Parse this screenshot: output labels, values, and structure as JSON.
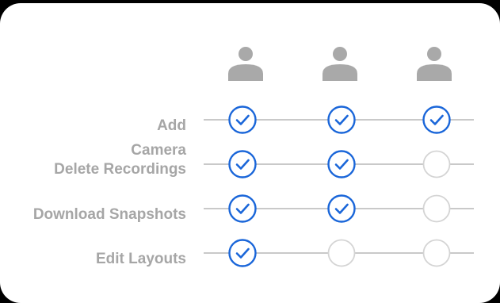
{
  "permissions_matrix": {
    "users": [
      {
        "icon": "user-icon"
      },
      {
        "icon": "user-icon"
      },
      {
        "icon": "user-icon"
      }
    ],
    "rows": [
      {
        "label": "Add",
        "checks": [
          true,
          true,
          true
        ]
      },
      {
        "label": "Camera",
        "checks": null
      },
      {
        "label": "Delete Recordings",
        "checks": [
          true,
          true,
          false
        ]
      },
      {
        "label": "Download Snapshots",
        "checks": [
          true,
          true,
          false
        ]
      },
      {
        "label": "Edit Layouts",
        "checks": [
          true,
          false,
          false
        ]
      }
    ]
  },
  "colors": {
    "checked": "#1a66d9",
    "unchecked": "#d4d4d4",
    "label": "#a6a6a6",
    "avatar": "#a9a9a9",
    "line": "#c9c9c9"
  }
}
